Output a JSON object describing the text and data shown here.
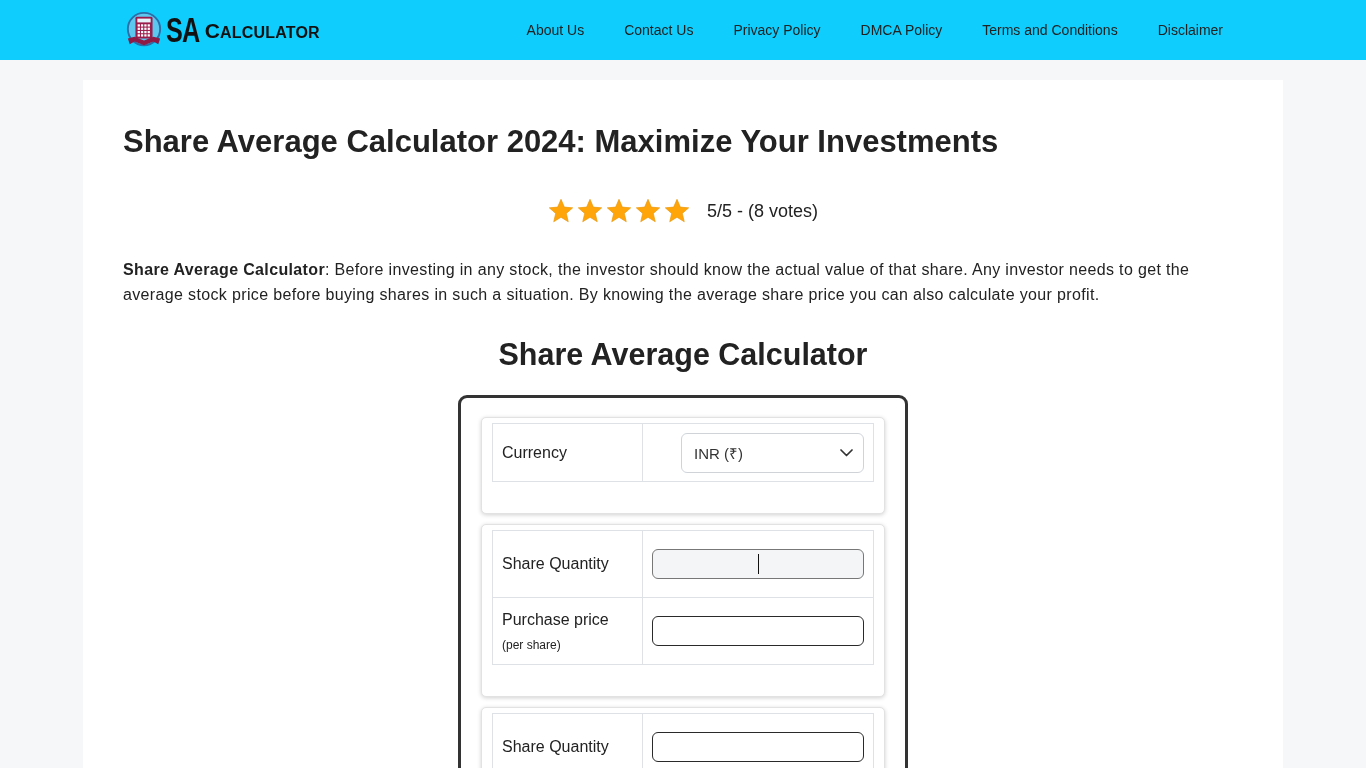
{
  "header": {
    "logo": {
      "initials": "SA",
      "word": "CALCULATOR"
    },
    "nav": [
      "About Us",
      "Contact Us",
      "Privacy Policy",
      "DMCA Policy",
      "Terms and Conditions",
      "Disclaimer"
    ]
  },
  "article": {
    "title": "Share Average Calculator 2024: Maximize Your Investments",
    "rating": {
      "stars": 5,
      "text": "5/5 - (8 votes)"
    },
    "intro": "**Share Average Calculator**: Before investing in any stock, the investor should know the actual value of that share. Any investor needs to get the average stock price before buying shares in such a situation. By knowing the average share price you can also calculate your profit.",
    "calculator": {
      "title": "Share Average Calculator",
      "sections": [
        {
          "rows": [
            {
              "kind": "select",
              "label": "Currency",
              "value": "INR (₹)"
            }
          ]
        },
        {
          "rows": [
            {
              "kind": "input",
              "label": "Share Quantity",
              "focused": true
            },
            {
              "kind": "input",
              "label": "Purchase price",
              "note": "(per share)",
              "focused": false
            }
          ]
        },
        {
          "rows": [
            {
              "kind": "input",
              "label": "Share Quantity",
              "focused": false
            }
          ]
        }
      ]
    }
  }
}
